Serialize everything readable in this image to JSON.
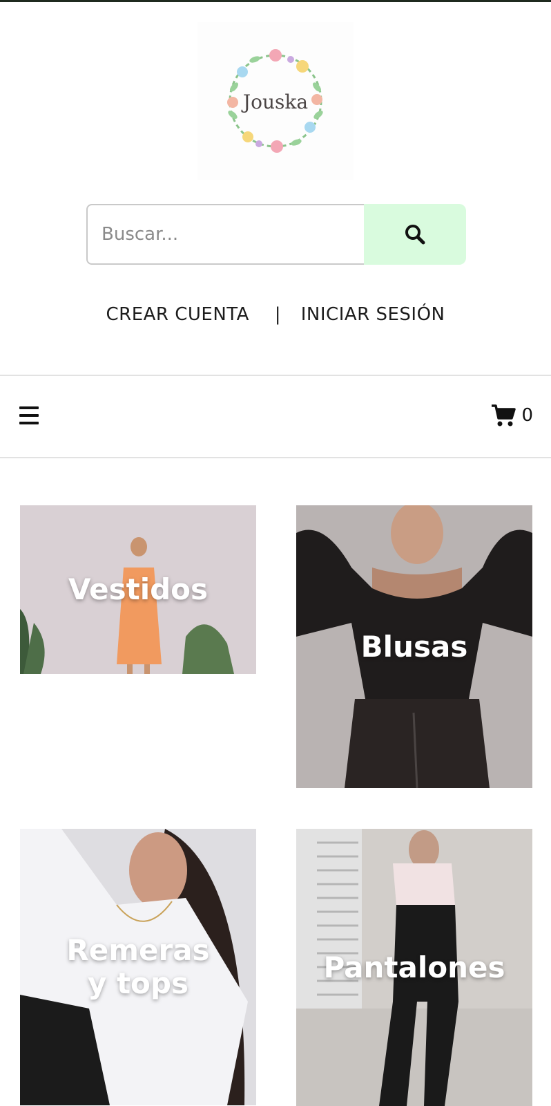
{
  "brand": {
    "logo_text": "Jouska"
  },
  "search": {
    "placeholder": "Buscar..."
  },
  "account": {
    "create_label": "CREAR CUENTA",
    "separator": "|",
    "login_label": "INICIAR SESIÓN"
  },
  "nav": {
    "cart_count": "0"
  },
  "categories": [
    {
      "label": "Vestidos"
    },
    {
      "label": "Blusas"
    },
    {
      "label": "Remeras\ny tops"
    },
    {
      "label": "Pantalones"
    }
  ],
  "colors": {
    "search_button_bg": "#d9fbde",
    "text": "#1c1c1c",
    "divider": "#e2e2e2"
  },
  "icons": {
    "search": "search-icon",
    "menu": "hamburger-icon",
    "cart": "cart-icon"
  }
}
